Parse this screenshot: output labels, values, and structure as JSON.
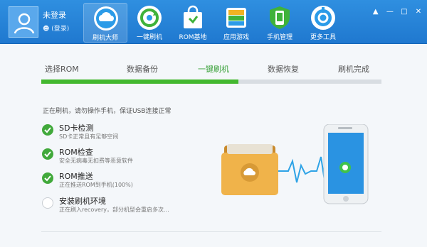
{
  "colors": {
    "header": "#2385d8",
    "accent_green": "#43b82f",
    "check_green": "#41a93b"
  },
  "user": {
    "name": "未登录",
    "login": "(登录)"
  },
  "nav": [
    {
      "label": "刷机大师",
      "icon": "cloud-icon",
      "active": true
    },
    {
      "label": "一键刷机",
      "icon": "refresh-icon",
      "active": false
    },
    {
      "label": "ROM基地",
      "icon": "shopping-bag-icon",
      "active": false
    },
    {
      "label": "应用游戏",
      "icon": "app-grid-icon",
      "active": false
    },
    {
      "label": "手机管理",
      "icon": "phone-manage-icon",
      "active": false
    },
    {
      "label": "更多工具",
      "icon": "tools-icon",
      "active": false
    }
  ],
  "window_controls": [
    "minimize-icon",
    "maximize-icon",
    "restore-icon",
    "close-icon"
  ],
  "steps": [
    {
      "label": "选择ROM"
    },
    {
      "label": "数据备份"
    },
    {
      "label": "一键刷机"
    },
    {
      "label": "数据恢复"
    },
    {
      "label": "刷机完成"
    }
  ],
  "progress": {
    "fraction": 0.58
  },
  "status_line": "正在刷机，请勿操作手机，保证USB连接正常",
  "checks": [
    {
      "title": "SD卡检测",
      "sub": "SD卡正常且有足够空间",
      "done": true
    },
    {
      "title": "ROM检查",
      "sub": "安全无病毒无扣费等恶意软件",
      "done": true
    },
    {
      "title": "ROM推送",
      "sub": "正在推送ROM到手机(100%)",
      "done": true
    },
    {
      "title": "安装刷机环境",
      "sub": "正在刷入recovery，部分机型会重启多次...",
      "done": false
    }
  ],
  "illustration": {
    "folder_icon": "cloud-folder-icon",
    "phone_icon": "smartphone-icon"
  }
}
